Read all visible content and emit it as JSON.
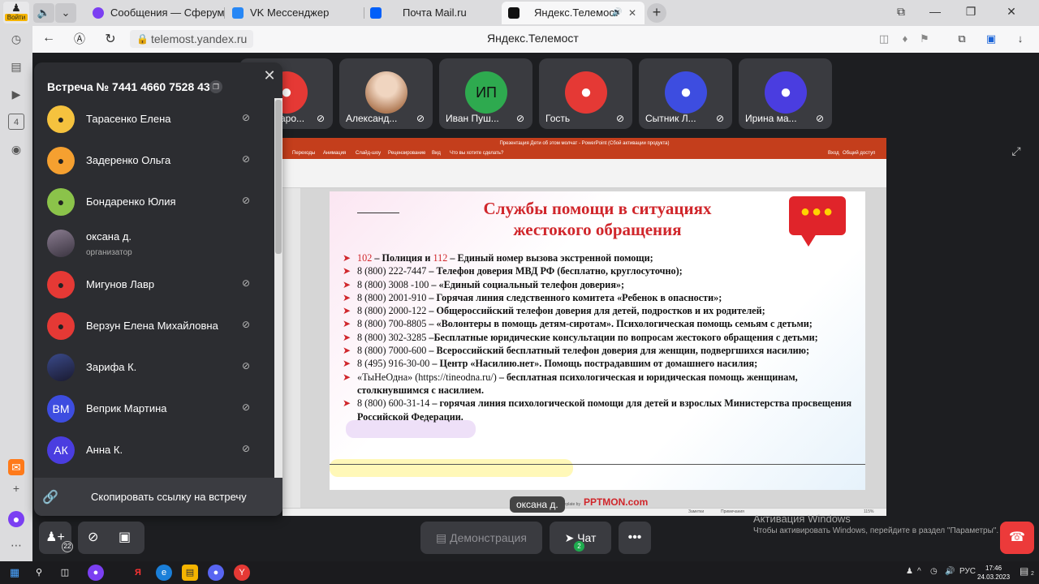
{
  "browser": {
    "login_label": "Войти",
    "tabs": [
      {
        "title": "Сообщения — Сферум",
        "icon_color": "#7b3ff2"
      },
      {
        "title": "VK Мессенджер",
        "icon_color": "#2787f5"
      },
      {
        "title": "Почта Mail.ru",
        "icon_color": "#005ff9"
      },
      {
        "title": "Яндекс.Телемост",
        "icon_color": "#111111"
      }
    ],
    "url": "telemost.yandex.ru",
    "page_title": "Яндекс.Телемост",
    "sidebar_badge": "4"
  },
  "thumbnails": [
    {
      "name": "Миронова Ларо...",
      "short": "аро...",
      "color": "#e53935",
      "type": "person"
    },
    {
      "name": "Александ...",
      "color": "#cccccc",
      "type": "photo"
    },
    {
      "name": "Иван Пуш...",
      "initials": "ИП",
      "color": "#2eaa4f",
      "type": "initials"
    },
    {
      "name": "Гость",
      "color": "#e53935",
      "type": "person"
    },
    {
      "name": "Сытник Л...",
      "color": "#3d4de0",
      "type": "person"
    },
    {
      "name": "Ирина ма...",
      "color": "#4a3de0",
      "type": "person"
    }
  ],
  "panel": {
    "title": "Встреча № 7441 4660 7528 43",
    "copy_link_label": "Скопировать ссылку на встречу",
    "participants": [
      {
        "name": "Тарасенко Елена",
        "avatar_color": "#f5c23e",
        "initials": "",
        "role": ""
      },
      {
        "name": "Задеренко Ольга",
        "avatar_color": "#f5a030",
        "initials": "",
        "role": ""
      },
      {
        "name": "Бондаренко Юлия",
        "avatar_color": "#8bc34a",
        "initials": "",
        "role": ""
      },
      {
        "name": "оксана д.",
        "avatar_color": "photo",
        "initials": "",
        "role": "организатор"
      },
      {
        "name": "Мигунов Лавр",
        "avatar_color": "#e53935",
        "initials": "",
        "role": ""
      },
      {
        "name": "Верзун Елена Михайловна",
        "avatar_color": "#e53935",
        "initials": "",
        "role": ""
      },
      {
        "name": "Зарифа К.",
        "avatar_color": "photo",
        "initials": "",
        "role": ""
      },
      {
        "name": "Веприк Мартина",
        "avatar_color": "#3d4de0",
        "initials": "ВМ",
        "role": ""
      },
      {
        "name": "Анна К.",
        "avatar_color": "#4a3de0",
        "initials": "АК",
        "role": ""
      }
    ]
  },
  "slide": {
    "ppt_title": "Презентация Дети об этом молчат - PowerPoint (Сбой активации продукта)",
    "ribbon_tabs": [
      "Переходы",
      "Анимация",
      "Слайд-шоу",
      "Рецензирование",
      "Вид",
      "Что вы хотите сделать?",
      "Вход",
      "Общий доступ"
    ],
    "title_line1": "Службы помощи в ситуациях",
    "title_line2": "жестокого обращения",
    "items": [
      {
        "red1": "102",
        "mid": " – ",
        "red2": "112",
        "pre": "Полиция и ",
        "rest": " – Единый номер вызова экстренной помощи;"
      },
      {
        "num": "8 (800) 222-7447",
        "rest": " – Телефон доверия МВД РФ (бесплатно, круглосуточно);"
      },
      {
        "num": "8 (800) 3008 -100",
        "rest": " – «Единый социальный телефон доверия»;"
      },
      {
        "num": "8 (800) 2001-910",
        "rest": " – Горячая линия следственного комитета «Ребенок в опасности»;"
      },
      {
        "num": "8 (800) 2000-122",
        "rest": " – Общероссийский телефон доверия для детей, подростков и их родителей;"
      },
      {
        "num": "8 (800) 700-8805",
        "rest": " – «Волонтеры в помощь детям-сиротам». Психологическая помощь семьям с детьми;"
      },
      {
        "num": "8 (800) 302-3285",
        "rest": " –Бесплатные юридические консультации по вопросам жестокого обращения с детьми;"
      },
      {
        "num": "8 (800) 7000-600",
        "rest": " – Всероссийский бесплатный телефон доверия для женщин, подвергшихся насилию;"
      },
      {
        "num": "8 (495) 916-30-00",
        "rest": " – Центр «Насилию.нет». Помощь пострадавшим от домашнего насилия;"
      },
      {
        "num": " «ТыНеОдна» (https://tineodna.ru/)",
        "rest": " – бесплатная психологическая и юридическая помощь женщинам, столкнувшимся с насилием."
      },
      {
        "num": "8 (800) 600-31-14",
        "rest": " – горячая линия психологической помощи для детей и взрослых Министерства просвещения Российской Федерации."
      }
    ],
    "footer_template": "Template by",
    "footer_brand": "PPTMON.com",
    "status_notes": "Заметки",
    "status_comments": "Примечания",
    "status_zoom": "115%"
  },
  "speaker_label": "оксана д.",
  "controls": {
    "invite_badge": "22",
    "demo_label": "Демонстрация",
    "chat_label": "Чат",
    "chat_badge": "2",
    "more_label": "•••"
  },
  "activation": {
    "title": "Активация Windows",
    "subtitle": "Чтобы активировать Windows, перейдите в раздел \"Параметры\"."
  },
  "taskbar": {
    "lang": "РУС",
    "time": "17:46",
    "date": "24.03.2023",
    "notif_badge": "2"
  }
}
